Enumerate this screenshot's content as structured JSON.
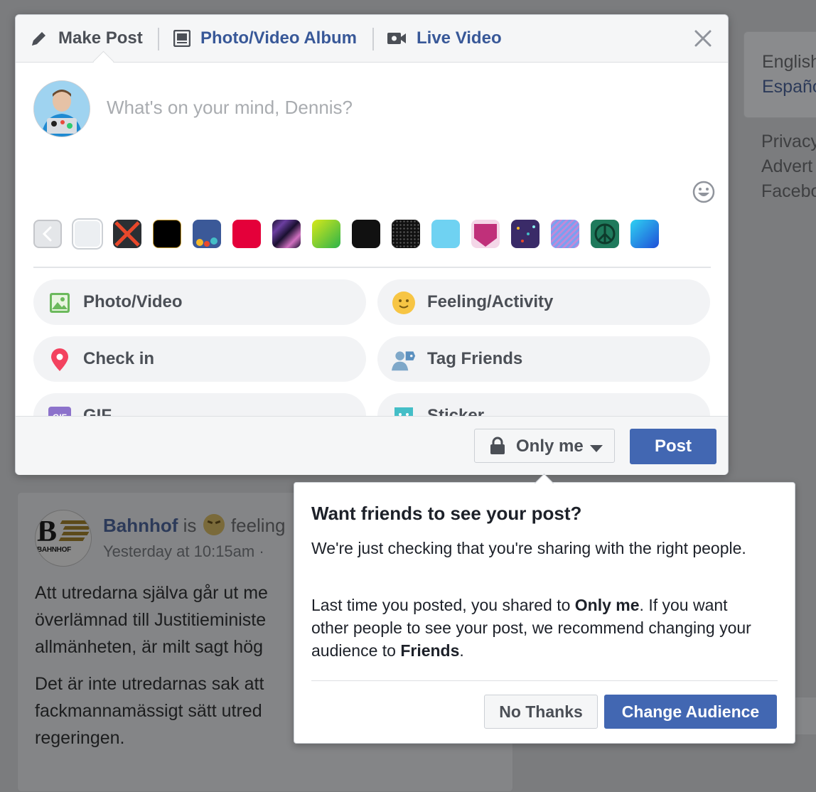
{
  "right_rail": {
    "languages": [
      "English",
      "Españo"
    ],
    "footer_links": [
      "Privacy",
      "Advert",
      "Facebo"
    ]
  },
  "feed_post": {
    "author": "Bahnhof",
    "verb": " is ",
    "feeling_word": "feeling",
    "timestamp": "Yesterday at 10:15am · ",
    "logo_text": "BAHNHOF",
    "paragraph1": [
      "Att utredarna själva går ut me",
      "överlämnad till Justitieministe",
      "allmänheten, är milt sagt hög"
    ],
    "paragraph2": [
      "Det är inte utredarnas sak att",
      "fackmannamässigt sätt utred",
      "regeringen."
    ]
  },
  "composer": {
    "tabs": [
      {
        "label": "Make Post",
        "icon": "pencil-icon",
        "color": "#4b4f56"
      },
      {
        "label": "Photo/Video Album",
        "icon": "album-icon",
        "color": "#385898"
      },
      {
        "label": "Live Video",
        "icon": "video-camera-icon",
        "color": "#385898"
      }
    ],
    "placeholder": "What's on your mind, Dennis?",
    "backgrounds": [
      {
        "name": "plain-white",
        "color": "#eceff2"
      },
      {
        "name": "red-x",
        "color": "#2b2f33"
      },
      {
        "name": "black-gold",
        "color": "#000000"
      },
      {
        "name": "blue-hearts",
        "color": "#3b5998"
      },
      {
        "name": "red",
        "color": "#e4003a"
      },
      {
        "name": "dark-swirl",
        "color": "#22143a"
      },
      {
        "name": "green-gradient",
        "color": "#8fd21a"
      },
      {
        "name": "black",
        "color": "#111111"
      },
      {
        "name": "black-dots",
        "color": "#111111"
      },
      {
        "name": "light-blue",
        "color": "#6fd2f2"
      },
      {
        "name": "pink-heart",
        "color": "#c0307a"
      },
      {
        "name": "purple-rain",
        "color": "#3a2b68"
      },
      {
        "name": "blue-lines",
        "color": "#6f8fe0"
      },
      {
        "name": "peace",
        "color": "#1f7a5c"
      },
      {
        "name": "blue-gradient",
        "color": "#0d8ae3"
      }
    ],
    "actions": [
      {
        "label": "Photo/Video",
        "icon": "photo-icon"
      },
      {
        "label": "Feeling/Activity",
        "icon": "smiley-icon"
      },
      {
        "label": "Check in",
        "icon": "location-pin-icon"
      },
      {
        "label": "Tag Friends",
        "icon": "tag-friends-icon"
      },
      {
        "label": "GIF",
        "icon": "gif-icon"
      },
      {
        "label": "Sticker",
        "icon": "sticker-icon"
      }
    ],
    "audience_label": "Only me",
    "post_label": "Post"
  },
  "audience_prompt": {
    "title": "Want friends to see your post?",
    "body1": "We're just checking that you're sharing with the right people.",
    "body2_prefix": "Last time you posted, you shared to ",
    "body2_bold1": "Only me",
    "body2_middle": ". If you want other people to see your post, we recommend changing your audience to ",
    "body2_bold2": "Friends",
    "body2_suffix": ".",
    "no_thanks_label": "No Thanks",
    "change_audience_label": "Change Audience"
  },
  "colors": {
    "brand_blue": "#4267b2",
    "link_blue": "#385898",
    "overlay": "#7b7c7e"
  }
}
